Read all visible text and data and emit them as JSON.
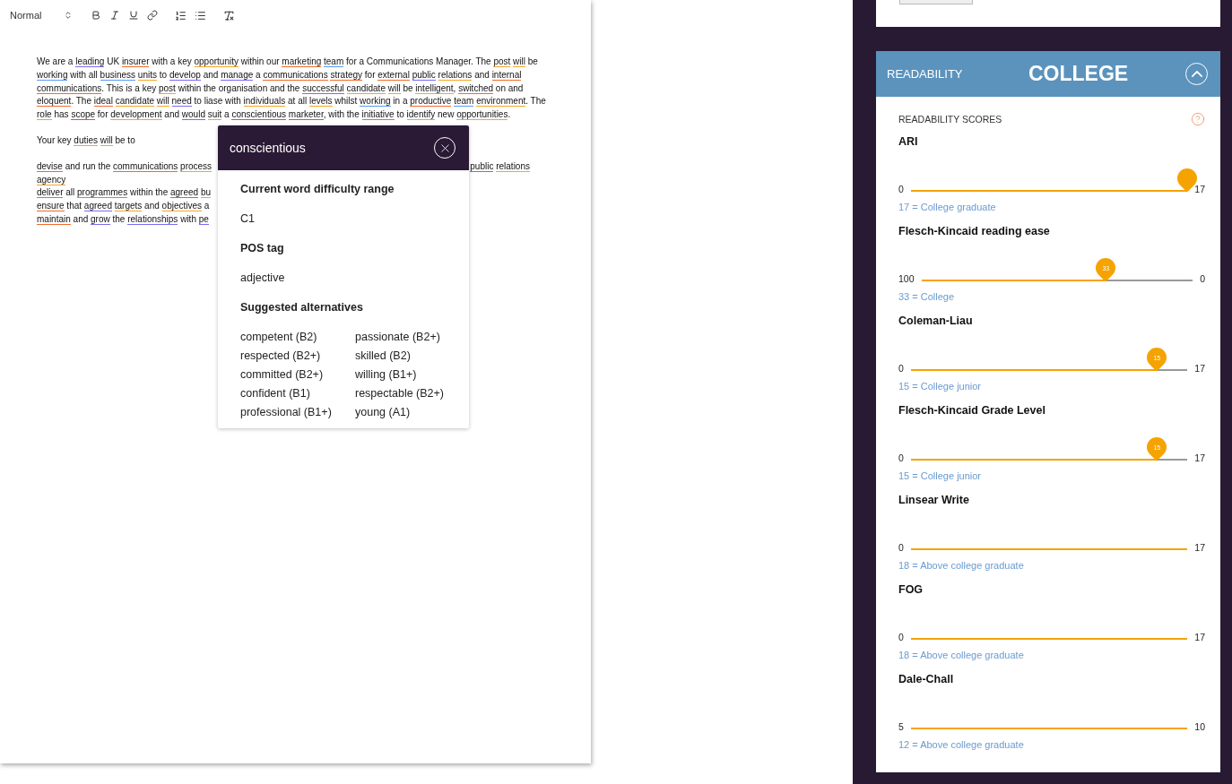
{
  "toolbar": {
    "format": "Normal"
  },
  "paragraphs": [
    {
      "tokens": [
        {
          "text": "We are a "
        },
        {
          "text": "leading",
          "color": "#7b6cf0"
        },
        {
          "text": " UK "
        },
        {
          "text": "insurer",
          "color": "#f06a2a"
        },
        {
          "text": " with a key "
        },
        {
          "text": "opportunity",
          "color": "#f5a623"
        },
        {
          "text": " within our "
        },
        {
          "text": "marketing ",
          "color": "#f06a2a"
        },
        {
          "text": "team",
          "color": "#5b9bf0"
        },
        {
          "text": " for a Communications Manager. The "
        },
        {
          "text": "post ",
          "color": "#f5a623"
        },
        {
          "text": "will",
          "color": "#f5a623"
        },
        {
          "text": " be "
        },
        {
          "text": "working",
          "color": "#5b9bf0"
        },
        {
          "text": " with all "
        },
        {
          "text": "business ",
          "color": "#5b9bf0"
        },
        {
          "text": "units",
          "color": "#f5a623"
        },
        {
          "text": " to "
        },
        {
          "text": "develop",
          "color": "#7b6cf0"
        },
        {
          "text": " and "
        },
        {
          "text": "manage",
          "color": "#7b6cf0"
        },
        {
          "text": " a "
        },
        {
          "text": "communications ",
          "color": "#f06a2a"
        },
        {
          "text": "strategy",
          "color": "#f06a2a"
        },
        {
          "text": " for "
        },
        {
          "text": "external ",
          "color": "#f06a2a"
        },
        {
          "text": "public ",
          "color": "#7b6cf0"
        },
        {
          "text": "relations",
          "color": "#f5a623"
        },
        {
          "text": " and "
        },
        {
          "text": "internal ",
          "color": "#f06a2a"
        },
        {
          "text": "communications",
          "color": "#f06a2a"
        },
        {
          "text": ". This is a key "
        },
        {
          "text": "post",
          "color": "#f5a623"
        },
        {
          "text": " within the organisation and the "
        },
        {
          "text": "successful ",
          "color": "#7b6cf0"
        },
        {
          "text": "candidate ",
          "color": "#f5a623"
        },
        {
          "text": "will",
          "color": "#f5a623"
        },
        {
          "text": " be "
        },
        {
          "text": "intelligent",
          "color": "#f5a623"
        },
        {
          "text": ", "
        },
        {
          "text": "switched",
          "color": "#f06a2a"
        },
        {
          "text": " on and "
        },
        {
          "text": "eloquent",
          "color": "#f06a2a"
        },
        {
          "text": ". The "
        },
        {
          "text": "ideal ",
          "color": "#f06a2a"
        },
        {
          "text": "candidate ",
          "color": "#f5a623"
        },
        {
          "text": "will ",
          "color": "#f5a623"
        },
        {
          "text": "need",
          "color": "#7b6cf0"
        },
        {
          "text": " to liase with "
        },
        {
          "text": "individuals",
          "color": "#f5a623"
        },
        {
          "text": " at all "
        },
        {
          "text": "levels",
          "color": "#f5a623"
        },
        {
          "text": " whilst "
        },
        {
          "text": "working",
          "color": "#5b9bf0"
        },
        {
          "text": " in a "
        },
        {
          "text": "productive ",
          "color": "#f06a2a"
        },
        {
          "text": "team ",
          "color": "#5b9bf0"
        },
        {
          "text": "environment",
          "color": "#f5a623"
        },
        {
          "text": ". The "
        },
        {
          "text": "role",
          "color": "#f5a623"
        },
        {
          "text": " has "
        },
        {
          "text": "scope",
          "color": "#e0408a"
        },
        {
          "text": " for "
        },
        {
          "text": "development",
          "color": "#f5a623"
        },
        {
          "text": " and "
        },
        {
          "text": "would ",
          "color": "#7b6cf0"
        },
        {
          "text": "suit",
          "color": "#f5a623"
        },
        {
          "text": " a "
        },
        {
          "text": "conscientious ",
          "color": "#e0408a"
        },
        {
          "text": "marketer",
          "color": "#e0408a"
        },
        {
          "text": ", with the "
        },
        {
          "text": "initiative",
          "color": "#f06a2a"
        },
        {
          "text": " to "
        },
        {
          "text": "identify",
          "color": "#f5a623"
        },
        {
          "text": " new "
        },
        {
          "text": "opportunities",
          "color": "#f5a623"
        },
        {
          "text": "."
        }
      ]
    },
    {
      "tokens": [
        {
          "text": "Your key "
        },
        {
          "text": "duties ",
          "color": "#f5a623"
        },
        {
          "text": "will",
          "color": "#f5a623"
        },
        {
          "text": " be to"
        }
      ]
    }
  ],
  "list_lines": [
    {
      "left": [
        {
          "text": "devise",
          "color": "#f06a2a"
        },
        {
          "text": " and run the "
        },
        {
          "text": "communications ",
          "color": "#f06a2a"
        },
        {
          "text": "process",
          "color": "#f5a623"
        }
      ],
      "right": [
        {
          "text": "public ",
          "color": "#7b6cf0"
        },
        {
          "text": "relations",
          "color": "#f5a623"
        }
      ]
    },
    {
      "left": [
        {
          "text": "agency",
          "color": "#f5a623"
        }
      ]
    },
    {
      "left": [
        {
          "text": "deliver",
          "color": "#f06a2a"
        },
        {
          "text": " all "
        },
        {
          "text": "programmes",
          "color": "#5b9bf0"
        },
        {
          "text": " within the "
        },
        {
          "text": "agreed ",
          "color": "#7b6cf0"
        },
        {
          "text": "bu",
          "color": "#f5a623"
        }
      ]
    },
    {
      "left": [
        {
          "text": "ensure",
          "color": "#f06a2a"
        },
        {
          "text": " that "
        },
        {
          "text": "agreed ",
          "color": "#7b6cf0"
        },
        {
          "text": "targets",
          "color": "#f5a623"
        },
        {
          "text": " and "
        },
        {
          "text": "objectives",
          "color": "#f5a623"
        },
        {
          "text": " a"
        }
      ]
    },
    {
      "left": [
        {
          "text": "maintain",
          "color": "#f06a2a"
        },
        {
          "text": " and "
        },
        {
          "text": "grow",
          "color": "#7b6cf0"
        },
        {
          "text": " the "
        },
        {
          "text": "relationships",
          "color": "#7b6cf0"
        },
        {
          "text": " with "
        },
        {
          "text": "pe",
          "color": "#7b6cf0"
        }
      ]
    }
  ],
  "popup": {
    "word": "conscientious",
    "details": [
      {
        "label": "Current word difficulty range",
        "value": "C1"
      },
      {
        "label": "POS tag",
        "value": "adjective"
      }
    ],
    "alternatives_heading": "Suggested alternatives",
    "alternatives": [
      "competent (B2)",
      "passionate (B2+)",
      "respected (B2+)",
      "skilled (B2)",
      "committed (B2+)",
      "willing (B1+)",
      "confident (B1)",
      "respectable (B2+)",
      "professional (B1+)",
      "young (A1)"
    ]
  },
  "readability": {
    "label": "READABILITY",
    "grade": "COLLEGE",
    "expanded": true,
    "scores_heading": "READABILITY SCORES",
    "scores": [
      {
        "name": "ARI",
        "min": "0",
        "max": "17",
        "level": 1,
        "pin": true,
        "caption": "17 = College graduate"
      },
      {
        "name": "Flesch-Kincaid reading ease",
        "min": "100",
        "max": "0",
        "level": 0.68,
        "pin": true,
        "pin_label": "33",
        "caption": "33 = College"
      },
      {
        "name": "Coleman-Liau",
        "min": "0",
        "max": "17",
        "level": 0.89,
        "pin": true,
        "pin_label": "15",
        "caption": "15 = College junior"
      },
      {
        "name": "Flesch-Kincaid Grade Level",
        "min": "0",
        "max": "17",
        "level": 0.89,
        "pin": true,
        "pin_label": "15",
        "caption": "15 = College junior"
      },
      {
        "name": "Linsear Write",
        "min": "0",
        "max": "17",
        "level": 1,
        "pin": false,
        "caption": "18 = Above college graduate"
      },
      {
        "name": "FOG",
        "min": "0",
        "max": "17",
        "level": 1,
        "pin": false,
        "caption": "18 = Above college graduate"
      },
      {
        "name": "Dale-Chall",
        "min": "5",
        "max": "10",
        "level": 1,
        "pin": false,
        "caption": "12 = Above college graduate"
      }
    ]
  }
}
